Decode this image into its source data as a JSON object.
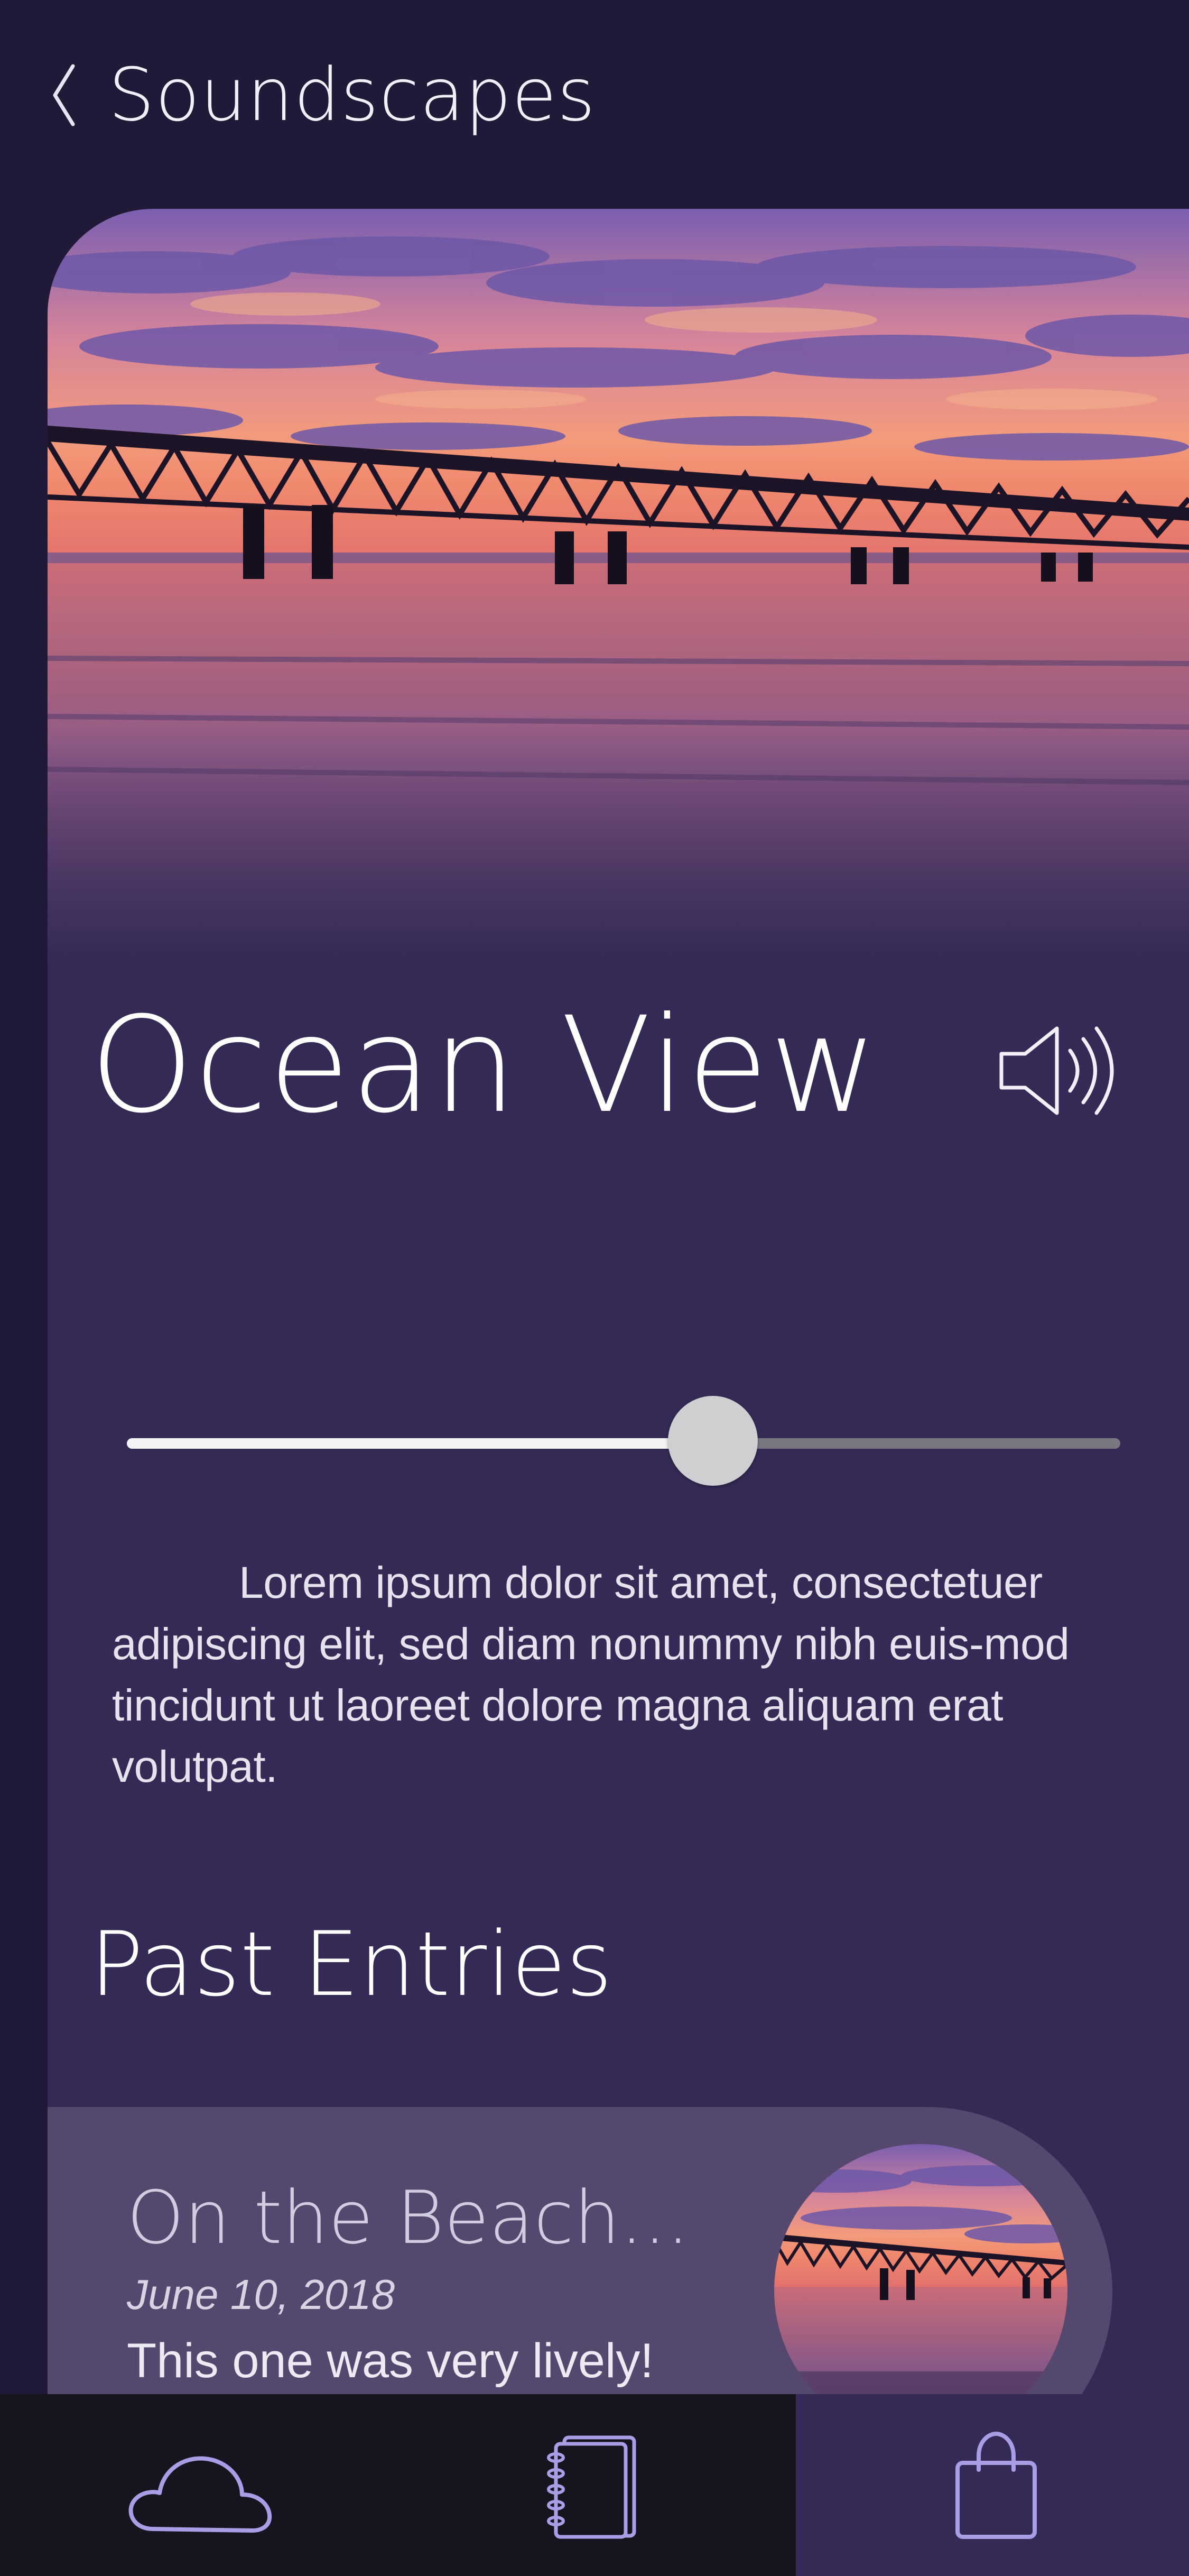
{
  "header": {
    "title": "Soundscapes",
    "back_icon": "chevron-left-icon"
  },
  "player": {
    "track_title": "Ocean View",
    "volume_icon": "speaker-volume-icon",
    "progress": 0.59,
    "description": "Lorem ipsum dolor sit amet, consectetuer adipiscing elit, sed diam nonummy nibh euis-mod tincidunt ut laoreet dolore magna aliquam erat volutpat."
  },
  "past_entries": {
    "title": "Past Entries",
    "items": [
      {
        "title": "On the Beach...",
        "date": "June 10, 2018",
        "note": "This one was very lively!"
      }
    ]
  },
  "nav": {
    "items": [
      {
        "icon": "cloud-icon",
        "active": false
      },
      {
        "icon": "journal-icon",
        "active": false
      },
      {
        "icon": "shopping-bag-icon",
        "active": true
      }
    ]
  },
  "colors": {
    "background": "#201a38",
    "card": "#352a55",
    "entry_card": "#54486f",
    "nav_dark": "#18141f",
    "icon_accent": "#a99ee6"
  }
}
